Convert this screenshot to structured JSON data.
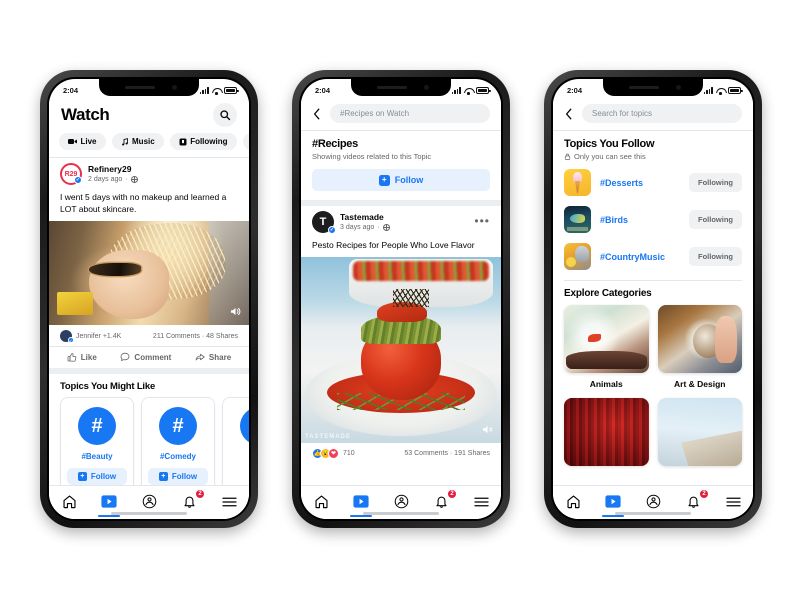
{
  "meta": {
    "background": "#ffffff",
    "accent": "#1877f2",
    "badge_color": "#e41e3f"
  },
  "status_bar": {
    "time": "2:04"
  },
  "phone1": {
    "header": {
      "title": "Watch",
      "search_icon": "search-icon"
    },
    "chips": [
      {
        "label": "Live",
        "icon": "video-camera-icon"
      },
      {
        "label": "Music",
        "icon": "music-note-icon"
      },
      {
        "label": "Following",
        "icon": "bookmark-icon"
      },
      {
        "label": "Sh",
        "icon": "shows-icon"
      }
    ],
    "post": {
      "author": "Refinery29",
      "avatar_text": "R29",
      "timestamp": "2 days ago",
      "privacy_icon": "globe-icon",
      "text": "I went 5 days with no makeup and learned a LOT about skincare.",
      "video_alt": "woman-with-sunglasses-video",
      "mute_icon": "speaker-on-icon",
      "engagement": {
        "friend_likes": "Jennifer +1.4K",
        "comments_shares": "211 Comments · 48 Shares"
      },
      "actions": [
        {
          "label": "Like",
          "icon": "thumbs-up-icon"
        },
        {
          "label": "Comment",
          "icon": "comment-bubble-icon"
        },
        {
          "label": "Share",
          "icon": "share-arrow-icon"
        }
      ]
    },
    "topics_section": {
      "title": "Topics You Might Like",
      "cards": [
        {
          "label": "#Beauty",
          "icon": "hashtag-icon",
          "follow_label": "Follow"
        },
        {
          "label": "#Comedy",
          "icon": "hashtag-icon",
          "follow_label": "Follow"
        },
        {
          "label": "",
          "icon": "hashtag-icon",
          "follow_label": ""
        }
      ]
    }
  },
  "phone2": {
    "search": {
      "back_icon": "back-chevron-icon",
      "value": "#Recipes on Watch"
    },
    "topic": {
      "title": "#Recipes",
      "subtitle": "Showing videos related to this Topic",
      "follow_label": "Follow",
      "follow_icon": "plus-square-icon"
    },
    "post": {
      "author": "Tastemade",
      "avatar_text": "T",
      "timestamp": "3 days ago",
      "privacy_icon": "globe-icon",
      "menu_icon": "more-options-icon",
      "text": "Pesto Recipes for People Who Love Flavor",
      "video_alt": "stuffed-tomato-pesto-video",
      "watermark": "TASTEMADE",
      "mute_icon": "speaker-muted-icon",
      "engagement": {
        "reaction_count": "710",
        "reactions": [
          "like",
          "care",
          "love"
        ],
        "comments_shares": "53 Comments · 191 Shares"
      }
    }
  },
  "phone3": {
    "search": {
      "back_icon": "back-chevron-icon",
      "placeholder": "Search for topics"
    },
    "follow_section": {
      "title": "Topics You Follow",
      "privacy_note": "Only you can see this",
      "privacy_icon": "lock-icon",
      "rows": [
        {
          "label": "#Desserts",
          "thumb": "ice-cream-thumbnail",
          "button": "Following"
        },
        {
          "label": "#Birds",
          "thumb": "blue-bird-thumbnail",
          "button": "Following"
        },
        {
          "label": "#CountryMusic",
          "thumb": "country-music-thumbnail",
          "button": "Following"
        }
      ]
    },
    "explore": {
      "title": "Explore Categories",
      "cells": [
        {
          "label": "Animals",
          "thumb": "fish-bowl-thumbnail"
        },
        {
          "label": "Art & Design",
          "thumb": "pottery-wheel-thumbnail"
        },
        {
          "label": "",
          "thumb": "red-curtain-thumbnail"
        },
        {
          "label": "",
          "thumb": "architecture-thumbnail"
        }
      ]
    }
  },
  "tabbar": {
    "items": [
      {
        "name": "home",
        "icon": "home-icon",
        "badge": ""
      },
      {
        "name": "watch",
        "icon": "watch-play-icon",
        "badge": ""
      },
      {
        "name": "groups",
        "icon": "groups-icon",
        "badge": ""
      },
      {
        "name": "notifications",
        "icon": "bell-icon",
        "badge": "2"
      },
      {
        "name": "menu",
        "icon": "hamburger-menu-icon",
        "badge": ""
      }
    ]
  }
}
